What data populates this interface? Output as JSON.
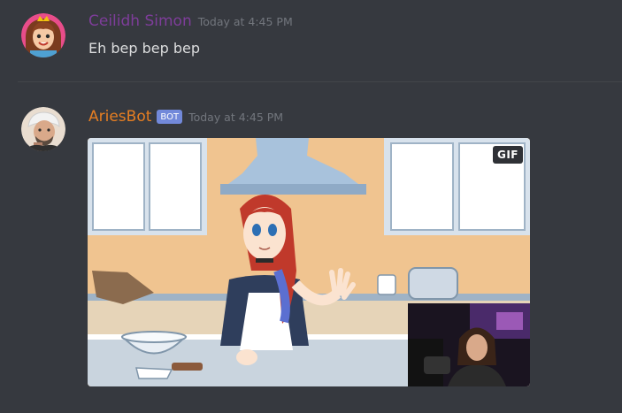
{
  "messages": [
    {
      "username": "Ceilidh Simon",
      "timestamp": "Today at 4:45 PM",
      "text": "Eh bep bep bep",
      "username_color": "#7e3d9a",
      "avatar": "cartoon-avatar-icon"
    },
    {
      "username": "AriesBot",
      "bot_tag": "BOT",
      "timestamp": "Today at 4:45 PM",
      "username_color": "#e67e22",
      "avatar": "bot-avatar-icon",
      "embed": {
        "type": "gif",
        "badge": "GIF"
      }
    }
  ],
  "colors": {
    "background": "#36393f",
    "timestamp": "#72767d",
    "message_text": "#dcddde",
    "bot_tag_bg": "#7289da"
  }
}
